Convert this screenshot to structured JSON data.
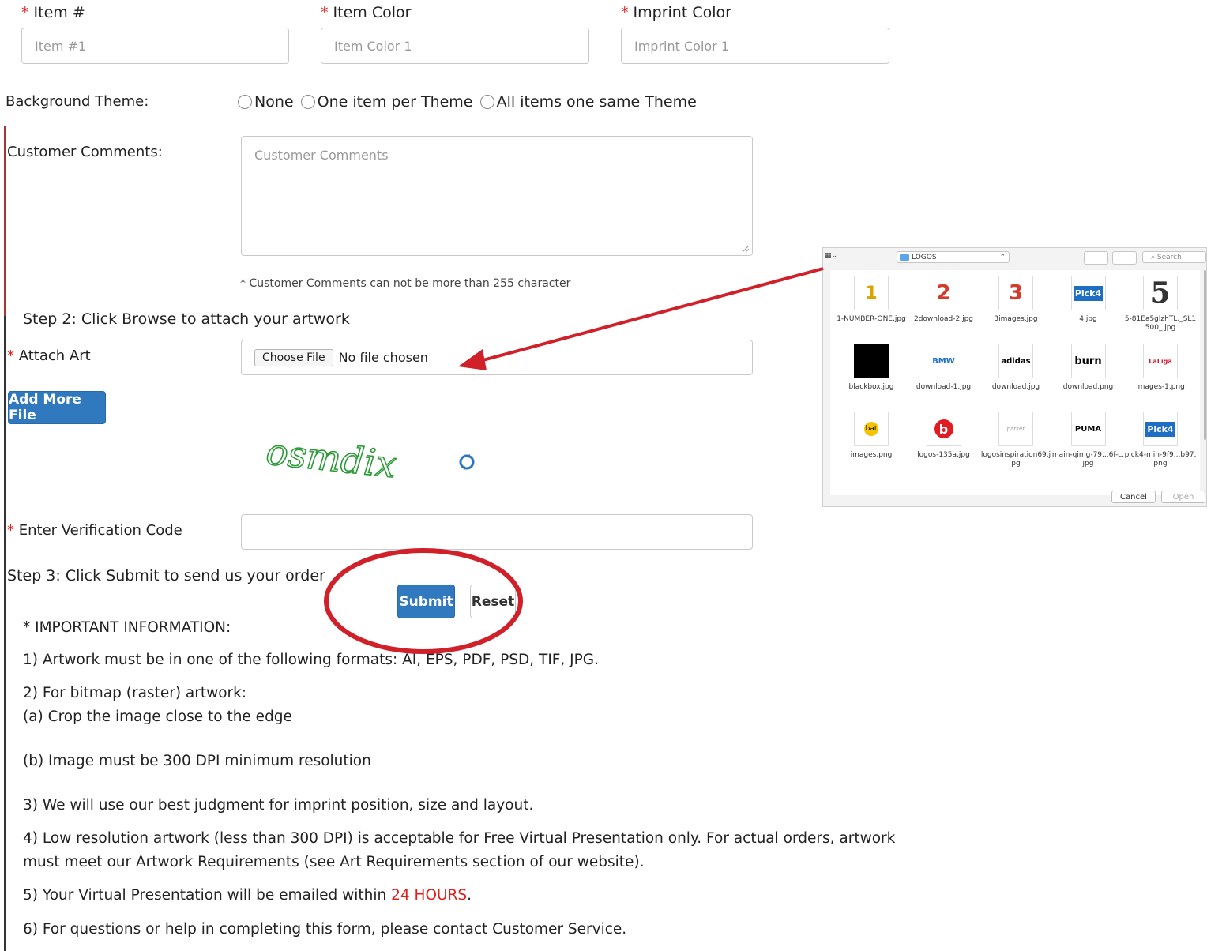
{
  "fields": {
    "item_label": "Item #",
    "item_placeholder": "Item #1",
    "item_color_label": "Item Color",
    "item_color_placeholder": "Item Color 1",
    "imprint_color_label": "Imprint Color",
    "imprint_color_placeholder": "Imprint Color 1"
  },
  "theme": {
    "label": "Background Theme:",
    "options": [
      "None",
      "One item per Theme",
      "All items one same Theme"
    ]
  },
  "comments": {
    "label": "Customer Comments:",
    "placeholder": "Customer Comments",
    "note": "* Customer Comments can not be more than 255 character"
  },
  "step2": {
    "title": "Step 2: Click Browse to attach your artwork",
    "attach_label": "Attach Art",
    "choose_file": "Choose File",
    "no_file": "No file chosen",
    "add_more": "Add More File"
  },
  "captcha": {
    "text": "osmdix",
    "verify_label": "Enter Verification Code"
  },
  "step3": {
    "title": "Step 3: Click Submit to send us your order",
    "submit": "Submit",
    "reset": "Reset"
  },
  "info": {
    "heading": "* IMPORTANT INFORMATION:",
    "line1": "1) Artwork must be in one of the following formats: AI, EPS, PDF, PSD, TIF, JPG.",
    "line2": "2) For bitmap (raster) artwork:",
    "line2a": "(a) Crop the image close to the edge",
    "line2b": "(b) Image must be 300 DPI minimum resolution",
    "line3": "3) We will use our best judgment for imprint position, size and layout.",
    "line4a": "4) Low resolution artwork (less than 300 DPI) is acceptable for Free Virtual Presentation only. For actual orders, artwork",
    "line4b": "must meet our Artwork Requirements (see Art Requirements section of our website).",
    "line5_pre": "5) Your Virtual Presentation will be emailed within ",
    "line5_highlight": "24 HOURS",
    "line5_post": ".",
    "line6": "6) For questions or help in completing this form, please contact Customer Service."
  },
  "dialog": {
    "folder": "LOGOS",
    "search": "Search",
    "cancel": "Cancel",
    "open": "Open",
    "files": [
      {
        "name": "1-NUMBER-ONE.jpg",
        "glyph": "1"
      },
      {
        "name": "2download-2.jpg",
        "glyph": "2"
      },
      {
        "name": "3images.jpg",
        "glyph": "3"
      },
      {
        "name": "4.jpg",
        "glyph": "Pick4"
      },
      {
        "name": "5-81Ea5glzhTL._SL1500_.jpg",
        "glyph": "5"
      },
      {
        "name": "blackbox.jpg",
        "glyph": ""
      },
      {
        "name": "download-1.jpg",
        "glyph": "BMW"
      },
      {
        "name": "download.jpg",
        "glyph": "adidas"
      },
      {
        "name": "download.png",
        "glyph": "burn"
      },
      {
        "name": "images-1.png",
        "glyph": "LaLiga"
      },
      {
        "name": "images.png",
        "glyph": "bat"
      },
      {
        "name": "logos-135a.jpg",
        "glyph": "b"
      },
      {
        "name": "logosinspiration69.jpg",
        "glyph": "parker"
      },
      {
        "name": "main-qimg-79...6f-c.jpg",
        "glyph": "PUMA"
      },
      {
        "name": "pick4-min-9f9...b97.png",
        "glyph": "Pick4"
      }
    ]
  },
  "colors": {
    "accent": "#3079be",
    "required": "#e0201b",
    "annotation": "#d0202a",
    "highlight": "#e0201b"
  }
}
